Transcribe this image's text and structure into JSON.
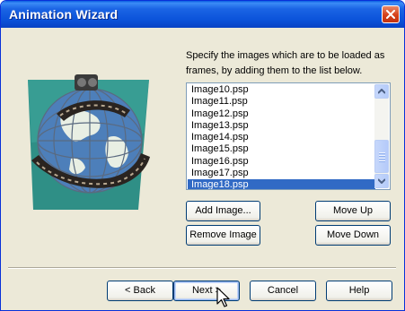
{
  "window": {
    "title": "Animation Wizard"
  },
  "instructions": "Specify the images which are to be loaded as frames, by adding them to the list below.",
  "frames_list": {
    "items": [
      "Image10.psp",
      "Image11.psp",
      "Image12.psp",
      "Image13.psp",
      "Image14.psp",
      "Image15.psp",
      "Image16.psp",
      "Image17.psp",
      "Image18.psp"
    ],
    "selected": "Image18.psp"
  },
  "buttons": {
    "add_image": "Add Image...",
    "remove_image": "Remove Image",
    "move_up": "Move Up",
    "move_down": "Move Down",
    "back": "< Back",
    "next": "Next >",
    "cancel": "Cancel",
    "help": "Help"
  },
  "icons": {
    "wizard_graphic": "globe-film-reel-icon",
    "close": "close-icon",
    "cursor": "mouse-pointer-icon"
  },
  "colors": {
    "title_bar": "#0b53da",
    "selection": "#316ac5",
    "close_button": "#d5401b",
    "dialog_bg": "#ece9d8"
  }
}
